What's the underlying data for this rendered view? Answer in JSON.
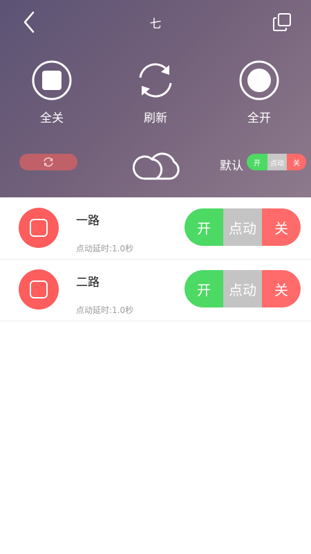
{
  "header": {
    "title": "七",
    "buttons": [
      {
        "label": "全关",
        "icon": "stop-square-icon"
      },
      {
        "label": "刷新",
        "icon": "refresh-icon"
      },
      {
        "label": "全开",
        "icon": "record-circle-icon"
      }
    ],
    "default_label": "默认",
    "mini_toggle": {
      "on": "开",
      "mid": "点动",
      "off": "关"
    }
  },
  "channels": [
    {
      "name": "一路",
      "delay": "点动延时:1.0秒",
      "on": "开",
      "mid": "点动",
      "off": "关"
    },
    {
      "name": "二路",
      "delay": "点动延时:1.0秒",
      "on": "开",
      "mid": "点动",
      "off": "关"
    }
  ],
  "colors": {
    "on": "#4cd964",
    "mid": "#c4c4c4",
    "off": "#ff6b6b",
    "icon_bg": "#fd5d5d"
  }
}
